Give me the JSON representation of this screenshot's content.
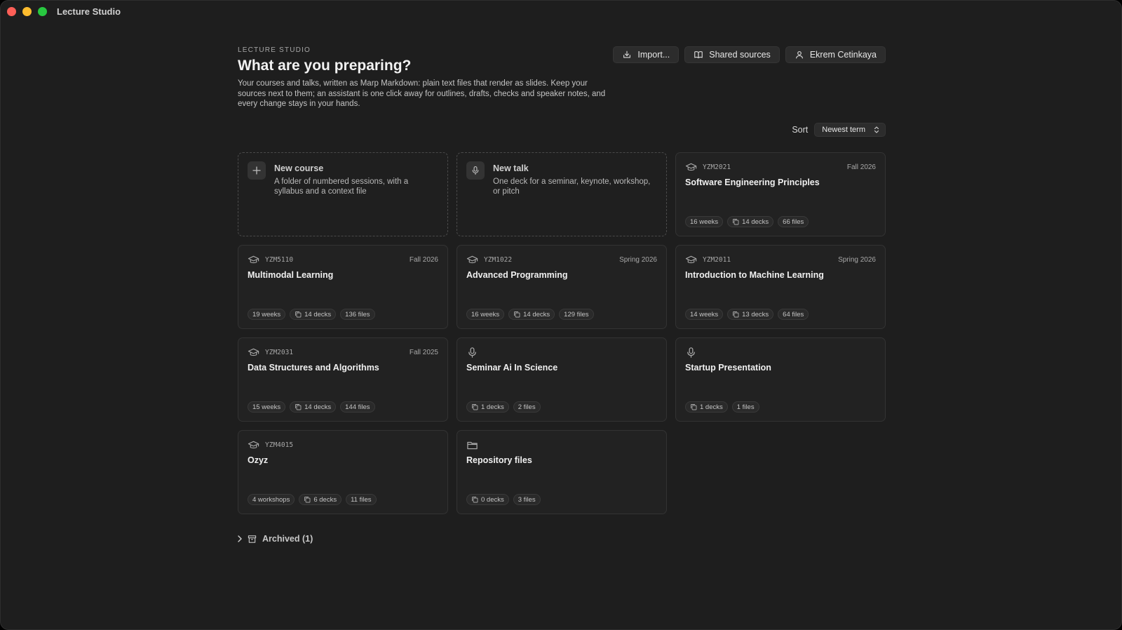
{
  "window": {
    "title": "Lecture Studio"
  },
  "header": {
    "eyebrow": "LECTURE STUDIO",
    "title": "What are you preparing?",
    "intro": "Your courses and talks, written as Marp Markdown: plain text files that render as slides. Keep your sources next to them; an assistant is one click away for outlines, drafts, checks and speaker notes, and every change stays in your hands."
  },
  "actions": {
    "import_label": "Import...",
    "shared_label": "Shared sources",
    "user_label": "Ekrem Cetinkaya"
  },
  "sort": {
    "label": "Sort",
    "value": "Newest term"
  },
  "new_course": {
    "title": "New course",
    "desc": "A folder of numbered sessions, with a syllabus and a context file"
  },
  "new_talk": {
    "title": "New talk",
    "desc": "One deck for a seminar, keynote, workshop, or pitch"
  },
  "cards": [
    {
      "code": "YZM2021",
      "term": "Fall 2026",
      "title": "Software Engineering Principles",
      "weeks": "16 weeks",
      "decks": "14 decks",
      "files": "66 files"
    },
    {
      "code": "YZM5110",
      "term": "Fall 2026",
      "title": "Multimodal Learning",
      "weeks": "19 weeks",
      "decks": "14 decks",
      "files": "136 files"
    },
    {
      "code": "YZM1022",
      "term": "Spring 2026",
      "title": "Advanced Programming",
      "weeks": "16 weeks",
      "decks": "14 decks",
      "files": "129 files"
    },
    {
      "code": "YZM2011",
      "term": "Spring 2026",
      "title": "Introduction to Machine Learning",
      "weeks": "14 weeks",
      "decks": "13 decks",
      "files": "64 files"
    },
    {
      "code": "YZM2031",
      "term": "Fall 2025",
      "title": "Data Structures and Algorithms",
      "weeks": "15 weeks",
      "decks": "14 decks",
      "files": "144 files"
    },
    {
      "title": "Seminar Ai In Science",
      "decks": "1 decks",
      "files": "2 files"
    },
    {
      "title": "Startup Presentation",
      "decks": "1 decks",
      "files": "1 files"
    },
    {
      "code": "YZM4015",
      "title": "Ozyz",
      "weeks": "4 workshops",
      "decks": "6 decks",
      "files": "11 files"
    },
    {
      "title": "Repository files",
      "decks": "0 decks",
      "files": "3 files"
    }
  ],
  "archived": {
    "label": "Archived (1)"
  },
  "colors": {
    "background": "#1e1e1e",
    "card": "#222222",
    "border": "#333333",
    "text": "#e6e6e6"
  },
  "icons": {
    "course": "graduation-cap-icon",
    "talk": "microphone-icon",
    "repo": "folder-icon",
    "decks": "copy-icon",
    "archive": "archive-box-icon"
  }
}
